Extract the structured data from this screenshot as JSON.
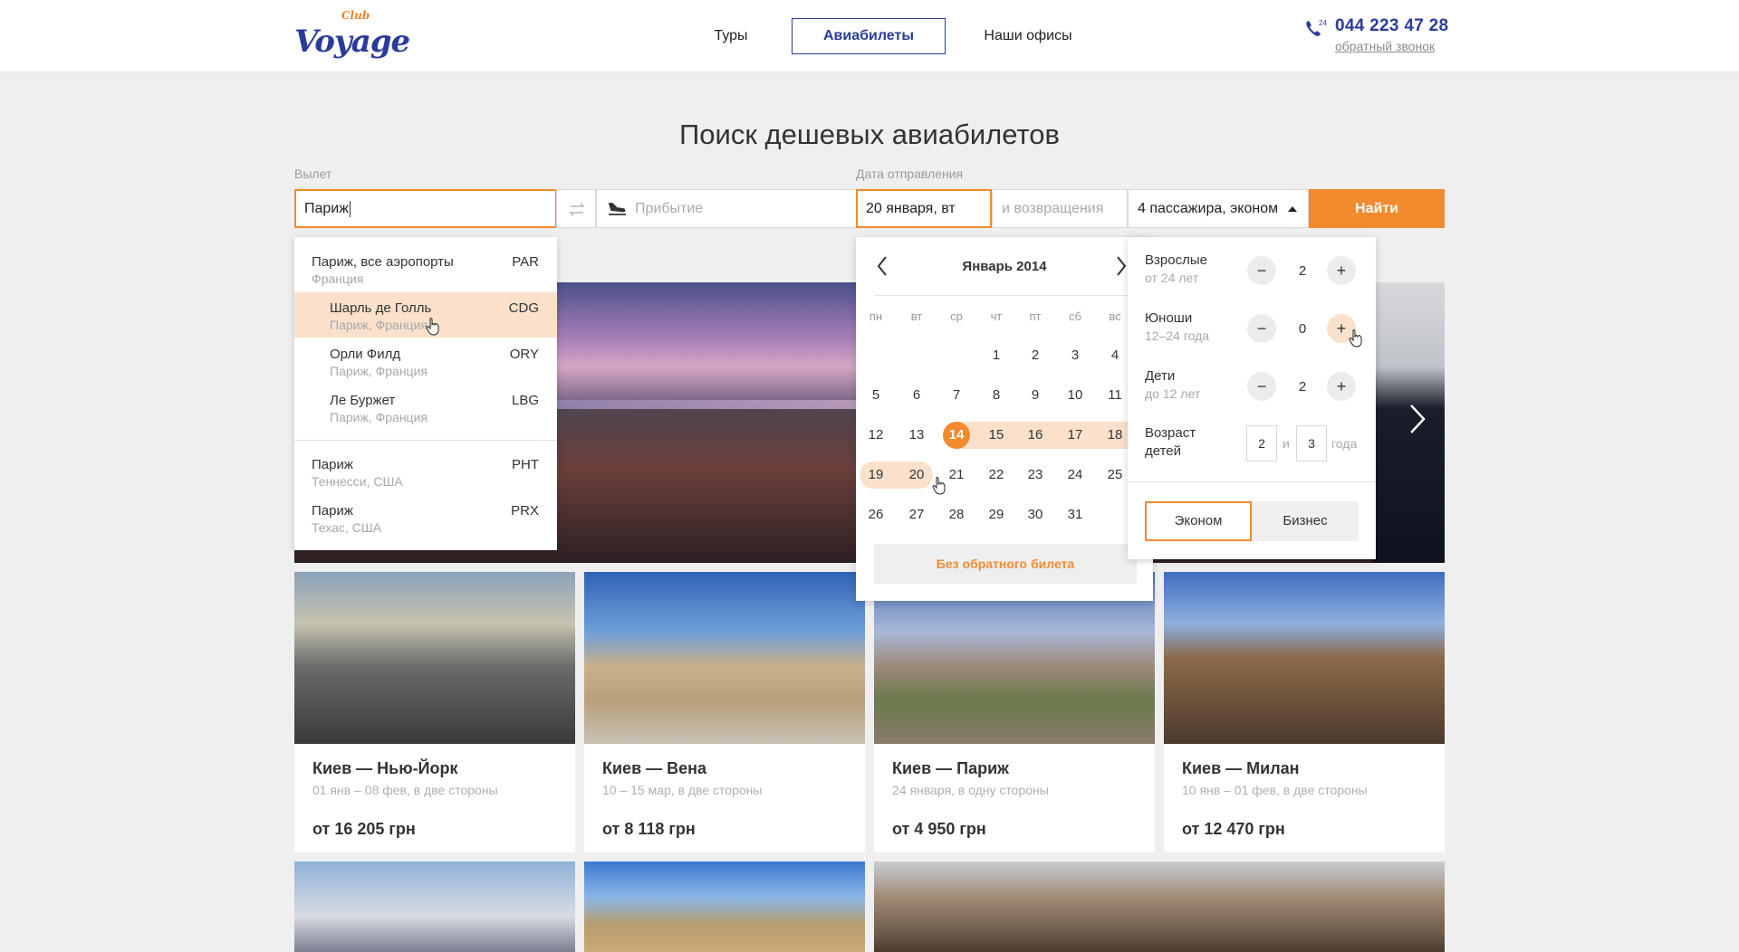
{
  "header": {
    "logo_text": "Voyage",
    "logo_club": "Club",
    "nav": [
      "Туры",
      "Авиабилеты",
      "Наши офисы"
    ],
    "phone_badge": "24",
    "phone": "044 223 47 28",
    "callback": "обратный звонок"
  },
  "search": {
    "title": "Поиск дешевых авиабилетов",
    "departure_label": "Вылет",
    "date_label": "Дата отправления",
    "departure_value": "Париж",
    "arrival_placeholder": "Прибытие",
    "date_value": "20 января, вт",
    "return_placeholder": "и возвращения",
    "passengers_value": "4 пассажира, эконом",
    "find_button": "Найти"
  },
  "autocomplete": [
    {
      "name": "Париж, все аэропорты",
      "sub": "Франция",
      "code": "PAR",
      "indent": false,
      "selected": false
    },
    {
      "name": "Шарль де Голль",
      "sub": "Париж, Франция",
      "code": "CDG",
      "indent": true,
      "selected": true
    },
    {
      "name": "Орли Филд",
      "sub": "Париж, Франция",
      "code": "ORY",
      "indent": true,
      "selected": false
    },
    {
      "name": "Ле Буржет",
      "sub": "Париж, Франция",
      "code": "LBG",
      "indent": true,
      "selected": false
    },
    {
      "name": "Париж",
      "sub": "Теннесси, США",
      "code": "PHT",
      "indent": false,
      "selected": false
    },
    {
      "name": "Париж",
      "sub": "Техас, США",
      "code": "PRX",
      "indent": false,
      "selected": false
    }
  ],
  "calendar": {
    "title": "Январь 2014",
    "weekdays": [
      "пн",
      "вт",
      "ср",
      "чт",
      "пт",
      "сб",
      "вс"
    ],
    "weeks": [
      [
        "",
        "",
        "",
        "1",
        "2",
        "3",
        "4"
      ],
      [
        "5",
        "6",
        "7",
        "8",
        "9",
        "10",
        "11"
      ],
      [
        "12",
        "13",
        "14",
        "15",
        "16",
        "17",
        "18"
      ],
      [
        "19",
        "20",
        "21",
        "22",
        "23",
        "24",
        "25"
      ],
      [
        "26",
        "27",
        "28",
        "29",
        "30",
        "31",
        ""
      ]
    ],
    "selected_day": "14",
    "range_end_day": "20",
    "no_return": "Без обратного билета"
  },
  "passengers": {
    "adults_label": "Взрослые",
    "adults_sub": "от 24 лет",
    "adults": "2",
    "youth_label": "Юноши",
    "youth_sub": "12–24 года",
    "youth": "0",
    "children_label": "Дети",
    "children_sub": "до 12 лет",
    "children": "2",
    "age_label_1": "Возраст",
    "age_label_2": "детей",
    "age_1": "2",
    "age_and": "и",
    "age_2": "3",
    "age_years": "года",
    "minus": "−",
    "plus": "+",
    "class_economy": "Эконом",
    "class_business": "Бизнес"
  },
  "cards": [
    {
      "route": "Киев — Нью-Йорк",
      "dates": "01 янв – 08 фев, в две стороны",
      "price": "от 16 205 грн"
    },
    {
      "route": "Киев — Вена",
      "dates": "10 – 15 мар, в две стороны",
      "price": "от 8 118 грн"
    },
    {
      "route": "Киев — Париж",
      "dates": "24 января, в одну стороны",
      "price": "от 4 950 грн"
    },
    {
      "route": "Киев — Милан",
      "dates": "10 янв – 01 фев, в две стороны",
      "price": "от 12 470 грн"
    }
  ],
  "colors": {
    "accent": "#f28a2e",
    "brand": "#2a3c9b",
    "highlight": "#fbe1cc"
  }
}
